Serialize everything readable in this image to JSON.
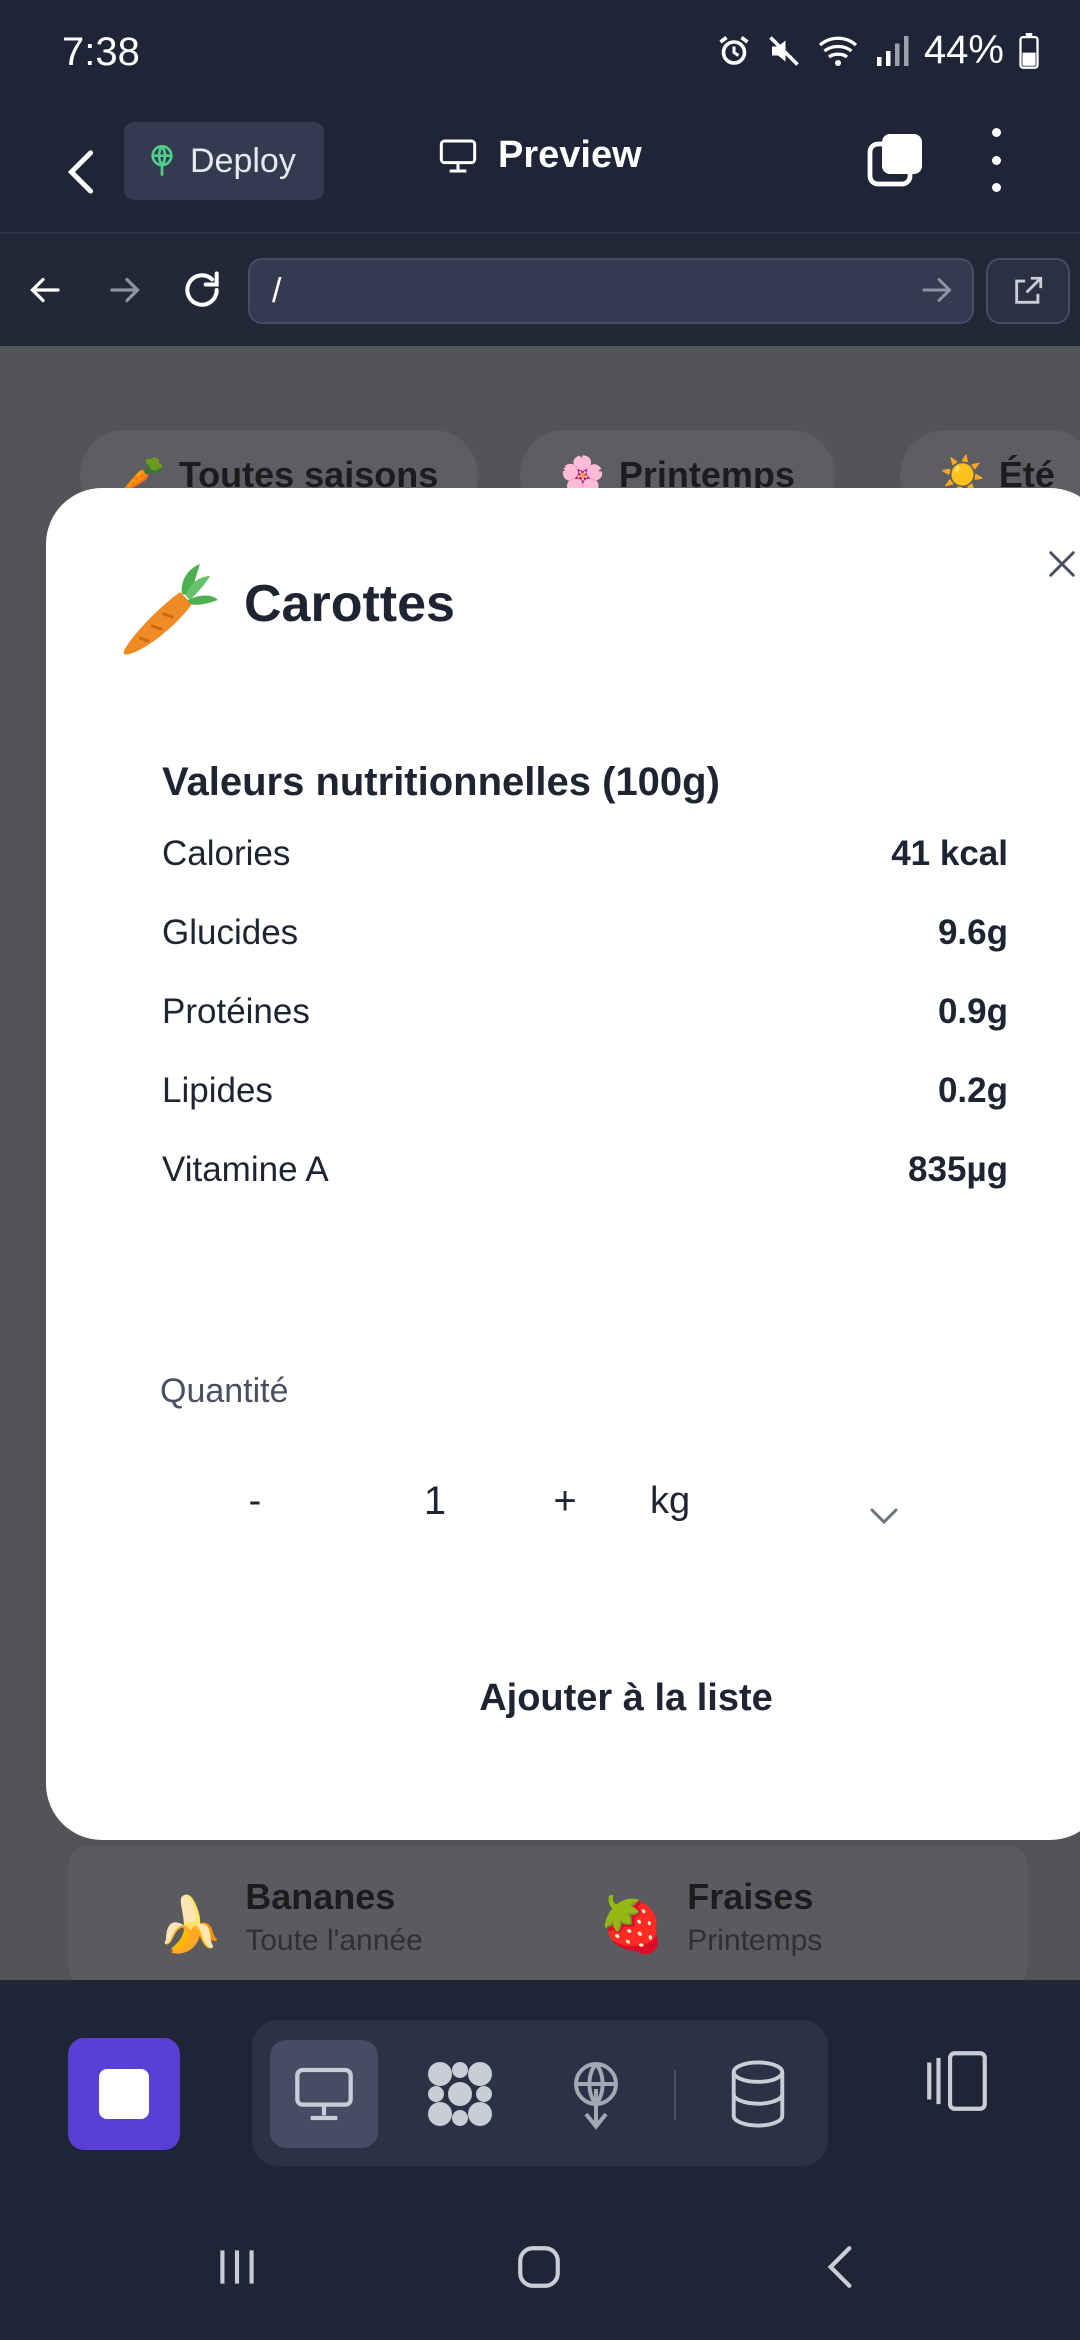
{
  "status_bar": {
    "time": "7:38",
    "battery": "44%",
    "icons": [
      "alarm-icon",
      "mute-icon",
      "wifi-icon",
      "signal-icon",
      "battery-icon"
    ]
  },
  "app_header": {
    "deploy_label": "Deploy",
    "preview_label": "Preview"
  },
  "browser": {
    "url": "/"
  },
  "background": {
    "chips": [
      {
        "emoji": "🥕",
        "label": "Toutes saisons"
      },
      {
        "emoji": "🌸",
        "label": "Printemps"
      },
      {
        "emoji": "☀️",
        "label": "Été"
      }
    ],
    "items": [
      {
        "emoji": "🍌",
        "name": "Bananes",
        "season": "Toute l'année"
      },
      {
        "emoji": "🍓",
        "name": "Fraises",
        "season": "Printemps"
      }
    ]
  },
  "modal": {
    "emoji": "🥕",
    "title": "Carottes",
    "nutrition_title": "Valeurs nutritionnelles (100g)",
    "nutrition": [
      {
        "label": "Calories",
        "value": "41 kcal"
      },
      {
        "label": "Glucides",
        "value": "9.6g"
      },
      {
        "label": "Protéines",
        "value": "0.9g"
      },
      {
        "label": "Lipides",
        "value": "0.2g"
      },
      {
        "label": "Vitamine A",
        "value": "835µg"
      }
    ],
    "quantity_label": "Quantité",
    "decrement": "-",
    "quantity": "1",
    "increment": "+",
    "unit": "kg",
    "add_button": "Ajouter à la liste"
  },
  "colors": {
    "header_bg": "#1f2436",
    "accent": "#5a3fd4",
    "overlay": "#525457",
    "modal_bg": "#ffffff"
  }
}
